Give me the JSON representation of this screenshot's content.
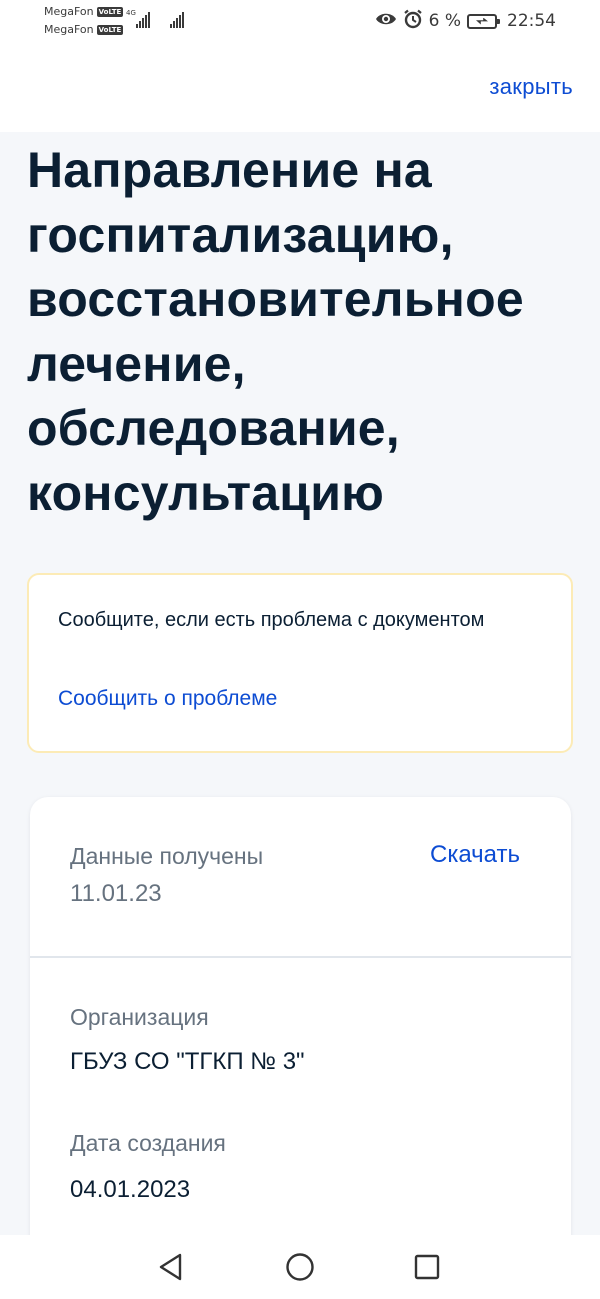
{
  "status_bar": {
    "carrier_1": "MegaFon",
    "carrier_2": "MegaFon",
    "volte": "VoLTE",
    "network": "4G",
    "battery": "6 %",
    "time": "22:54"
  },
  "header": {
    "close_label": "закрыть"
  },
  "main": {
    "title": "Направление на госпитализацию, восстановительное лечение, обследование, консультацию",
    "notice": {
      "text": "Сообщите, если есть проблема с документом",
      "link": "Сообщить о проблеме"
    },
    "details": {
      "received_label": "Данные получены",
      "received_date": "11.01.23",
      "download_label": "Скачать",
      "organization_label": "Организация",
      "organization_value": "ГБУЗ СО \"ТГКП № 3\"",
      "created_label": "Дата создания",
      "created_value": "04.01.2023"
    }
  },
  "colors": {
    "link": "#0d4cd3",
    "text": "#0b1f33",
    "secondary_text": "#66727f",
    "page_background": "#f5f7fa",
    "notice_border": "#fcebb6"
  }
}
